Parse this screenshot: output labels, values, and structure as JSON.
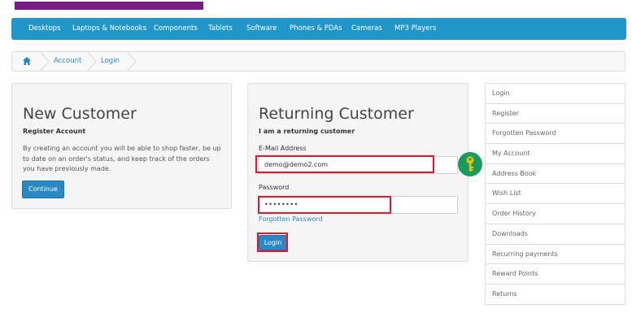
{
  "menu": {
    "items": [
      "Desktops",
      "Laptops & Notebooks",
      "Components",
      "Tablets",
      "Software",
      "Phones & PDAs",
      "Cameras",
      "MP3 Players"
    ]
  },
  "breadcrumb": {
    "home_icon": "home-icon",
    "items": [
      "Account",
      "Login"
    ]
  },
  "new_customer": {
    "title": "New Customer",
    "subtitle": "Register Account",
    "description": "By creating an account you will be able to shop faster, be up to date on an order's status, and keep track of the orders you have previously made.",
    "button": "Continue"
  },
  "returning_customer": {
    "title": "Returning Customer",
    "subtitle": "I am a returning customer",
    "email_label": "E-Mail Address",
    "email_value": "demo@demo2.com",
    "password_label": "Password",
    "password_value": "••••••••",
    "forgotten_link": "Forgotten Password",
    "login_button": "Login"
  },
  "sidebar": {
    "items": [
      "Login",
      "Register",
      "Forgotten Password",
      "My Account",
      "Address Book",
      "Wish List",
      "Order History",
      "Downloads",
      "Recurring payments",
      "Reward Points",
      "Returns"
    ]
  },
  "colors": {
    "menu_bg": "#2196c9",
    "accent_bar": "#7a1a86",
    "button": "#2a89c2",
    "highlight": "#e5152b",
    "key_badge": "#1a9a5c"
  }
}
